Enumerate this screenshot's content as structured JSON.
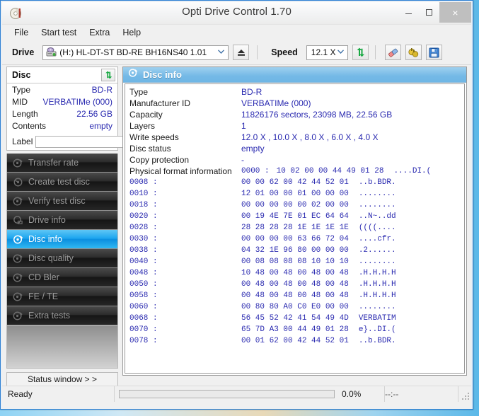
{
  "window": {
    "title": "Opti Drive Control 1.70",
    "icon": "disc-icon",
    "minimize": "minimize-icon",
    "maximize": "maximize-icon",
    "close": "×"
  },
  "menu": {
    "items": [
      "File",
      "Start test",
      "Extra",
      "Help"
    ]
  },
  "toolbar": {
    "drive_label": "Drive",
    "drive_value": "(H:)   HL-DT-ST BD-RE  BH16NS40 1.01",
    "eject_icon": "eject-icon",
    "speed_label": "Speed",
    "speed_value": "12.1 X",
    "refresh_icon": "refresh-icon",
    "erase_icon": "erase-icon",
    "settings_icon": "plug-icon",
    "save_icon": "save-icon",
    "combo_arrow": "⌄"
  },
  "disc_panel": {
    "header": "Disc",
    "refresh_icon": "refresh-icon",
    "rows": [
      {
        "key": "Type",
        "value": "BD-R"
      },
      {
        "key": "MID",
        "value": "VERBATIMe (000)"
      },
      {
        "key": "Length",
        "value": "22.56 GB"
      },
      {
        "key": "Contents",
        "value": "empty"
      }
    ],
    "label_key": "Label",
    "label_value": "",
    "label_placeholder": "",
    "cd_icon": "cd-icon"
  },
  "nav": {
    "items": [
      {
        "label": "Transfer rate",
        "icon": "disc-test-icon",
        "selected": false
      },
      {
        "label": "Create test disc",
        "icon": "disc-create-icon",
        "selected": false
      },
      {
        "label": "Verify test disc",
        "icon": "disc-verify-icon",
        "selected": false
      },
      {
        "label": "Drive info",
        "icon": "drive-info-icon",
        "selected": false
      },
      {
        "label": "Disc info",
        "icon": "disc-info-icon",
        "selected": true
      },
      {
        "label": "Disc quality",
        "icon": "disc-quality-icon",
        "selected": false
      },
      {
        "label": "CD Bler",
        "icon": "cd-bler-icon",
        "selected": false
      },
      {
        "label": "FE / TE",
        "icon": "fe-te-icon",
        "selected": false
      },
      {
        "label": "Extra tests",
        "icon": "extra-tests-icon",
        "selected": false
      }
    ],
    "status_window_button": "Status window > >"
  },
  "main": {
    "panel_title": "Disc info",
    "panel_icon": "disc-info-icon",
    "rows": [
      {
        "key": "Type",
        "value": "BD-R"
      },
      {
        "key": "Manufacturer ID",
        "value": "VERBATIMe (000)"
      },
      {
        "key": "Capacity",
        "value": "11826176 sectors, 23098 MB, 22.56 GB"
      },
      {
        "key": "Layers",
        "value": "1"
      },
      {
        "key": "Write speeds",
        "value": "12.0 X , 10.0 X , 8.0 X , 6.0 X , 4.0 X"
      },
      {
        "key": "Disc status",
        "value": "empty"
      },
      {
        "key": "Copy protection",
        "value": "-"
      }
    ],
    "physical_format_label": "Physical format information",
    "hex_dump": [
      {
        "offset": "0000 :",
        "bytes": "10 02 00 00 44 49 01 28",
        "ascii": "....DI.("
      },
      {
        "offset": "0008 :",
        "bytes": "00 00 62 00 42 44 52 01",
        "ascii": "..b.BDR."
      },
      {
        "offset": "0010 :",
        "bytes": "12 01 00 00 01 00 00 00",
        "ascii": "........"
      },
      {
        "offset": "0018 :",
        "bytes": "00 00 00 00 00 02 00 00",
        "ascii": "........"
      },
      {
        "offset": "0020 :",
        "bytes": "00 19 4E 7E 01 EC 64 64",
        "ascii": "..N~..dd"
      },
      {
        "offset": "0028 :",
        "bytes": "28 28 28 28 1E 1E 1E 1E",
        "ascii": "((((...."
      },
      {
        "offset": "0030 :",
        "bytes": "00 00 00 00 63 66 72 04",
        "ascii": "....cfr."
      },
      {
        "offset": "0038 :",
        "bytes": "04 32 1E 96 80 00 00 00",
        "ascii": ".2......"
      },
      {
        "offset": "0040 :",
        "bytes": "00 08 08 08 08 10 10 10",
        "ascii": "........"
      },
      {
        "offset": "0048 :",
        "bytes": "10 48 00 48 00 48 00 48",
        "ascii": ".H.H.H.H"
      },
      {
        "offset": "0050 :",
        "bytes": "00 48 00 48 00 48 00 48",
        "ascii": ".H.H.H.H"
      },
      {
        "offset": "0058 :",
        "bytes": "00 48 00 48 00 48 00 48",
        "ascii": ".H.H.H.H"
      },
      {
        "offset": "0060 :",
        "bytes": "00 80 80 A0 C0 E0 00 00",
        "ascii": "........"
      },
      {
        "offset": "0068 :",
        "bytes": "56 45 52 42 41 54 49 4D",
        "ascii": "VERBATIM"
      },
      {
        "offset": "0070 :",
        "bytes": "65 7D A3 00 44 49 01 28",
        "ascii": "e}..DI.("
      },
      {
        "offset": "0078 :",
        "bytes": "00 01 62 00 42 44 52 01",
        "ascii": "..b.BDR."
      }
    ]
  },
  "statusbar": {
    "ready": "Ready",
    "progress_pct": "0.0%",
    "progress_value": 0,
    "time": "--:--"
  },
  "colors": {
    "accent_blue": "#1ea6ef",
    "value_text": "#2a2ab0",
    "panel_header": "#74b9e6",
    "window_border": "#2a7fd4"
  }
}
